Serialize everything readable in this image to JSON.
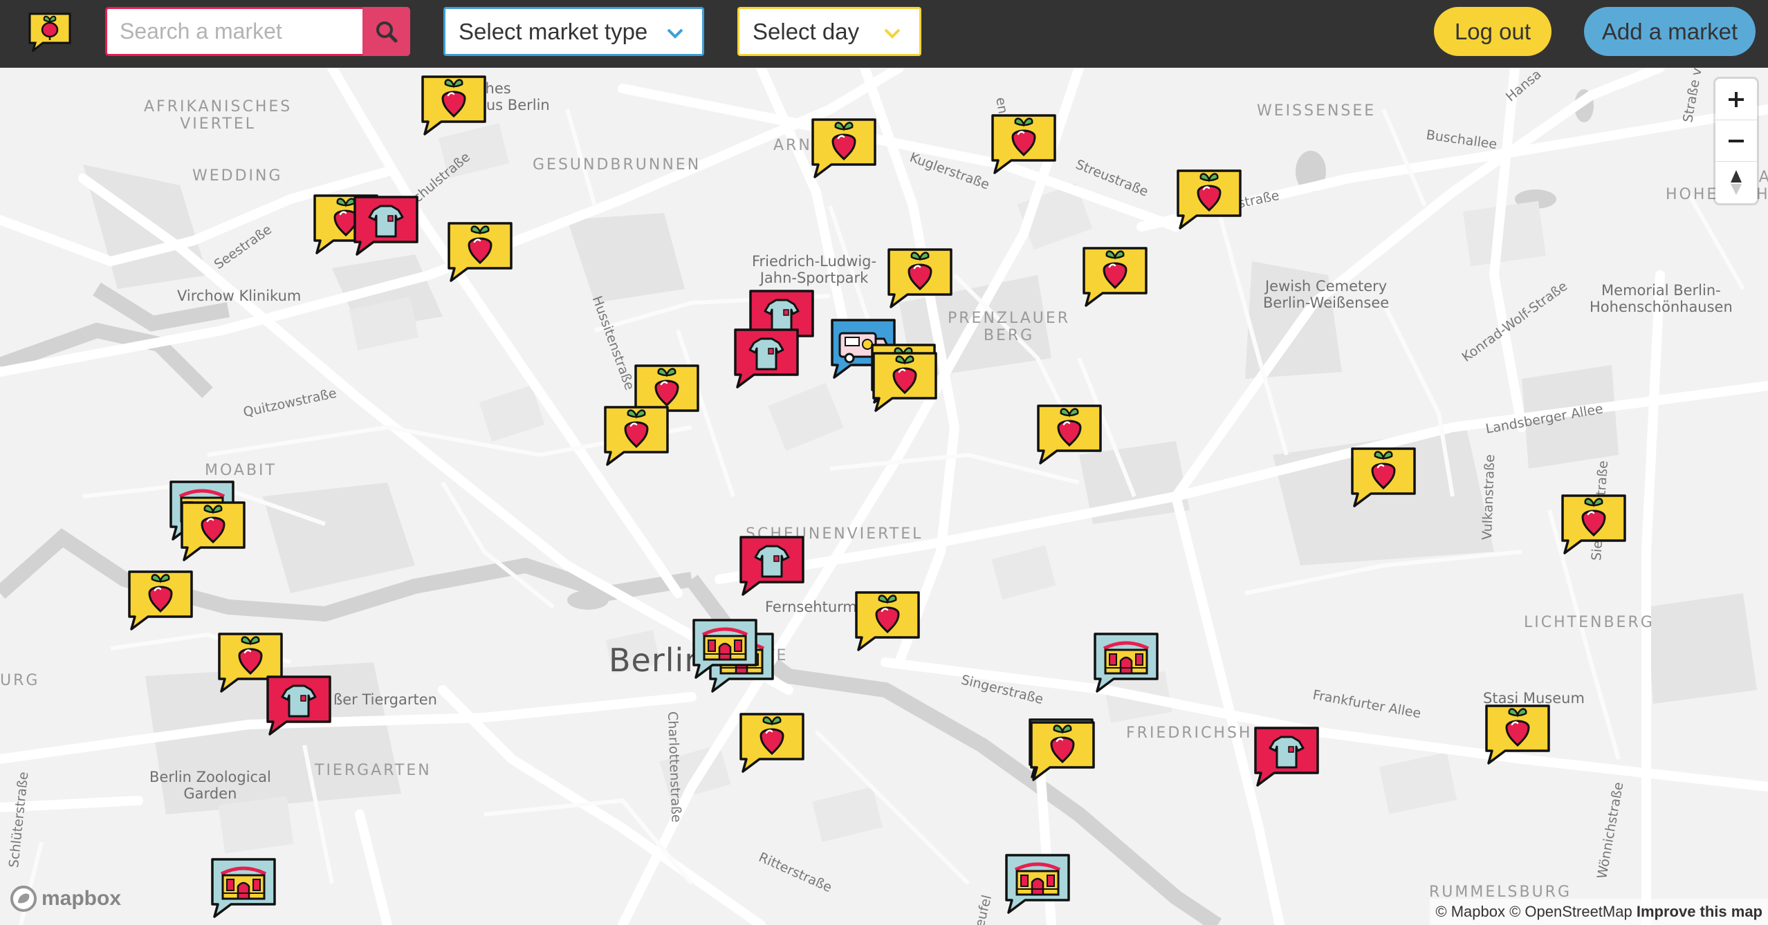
{
  "header": {
    "logo_icon": "beet-speech-bubble-logo",
    "search": {
      "placeholder": "Search a market",
      "value": "",
      "button_icon": "search-icon"
    },
    "market_type_select": {
      "selected": "Select market type",
      "icon": "chevron-down-icon"
    },
    "day_select": {
      "selected": "Select day",
      "icon": "chevron-down-icon"
    },
    "logout_label": "Log out",
    "add_market_label": "Add a market"
  },
  "colors": {
    "header_bg": "#333333",
    "food": "#f7d335",
    "clothing": "#e61f4f",
    "building": "#a9d6db",
    "truck": "#3e9ed9",
    "add_button": "#5aaad8"
  },
  "map": {
    "labels": {
      "afrikanisches": "AFRIKANISCHES\nVIERTEL",
      "wedding": "WEDDING",
      "gesundbrunnen": "GESUNDBRUNNEN",
      "weissensee": "WEISSENSEE",
      "alt_hohenschoen": "ALT-\nHOHENSCHÖN",
      "prenzlauer": "PRENZLAUER\nBERG",
      "moabit": "MOABIT",
      "scheunenviertel": "SCHEUNENVIERTEL",
      "lichtenberg": "LICHTENBERG",
      "friedrichsh": "FRIEDRICHSH",
      "tiergarten": "TIERGARTEN",
      "rummelsburg": "RUMMELSBURG",
      "urg": "URG",
      "arni": "ARNI",
      "mitte": "TE",
      "berlin": "Berlin",
      "virchow": "Virchow Klinikum",
      "fjs": "Friedrich-Ludwig-\nJahn-Sportpark",
      "jewish": "Jewish Cemetery\nBerlin-Weißensee",
      "memorial": "Memorial Berlin-\nHohenschönhausen",
      "fernsehturm": "Fernsehturm",
      "tiergarten_park": "ßer Tiergarten",
      "zoo": "Berlin Zoological\nGarden",
      "stasi": "Stasi Museum",
      "ches": "ches\naus Berlin",
      "seestrasse": "Seestraße",
      "schulstrasse": "chulstraße",
      "quitzow": "Quitzowstraße",
      "hussiten": "Hussitenstraße",
      "kugler": "Kuglerstraße",
      "streu": "Streustraße",
      "enade": "enade",
      "buschallee": "Buschallee",
      "hansa": "Hansa",
      "strasse_vor": "Straße vor",
      "astrasse": "straße",
      "konrad": "Konrad-Wolf-Straße",
      "landsberger": "Landsberger Allee",
      "vulkan": "Vulkanstraße",
      "siegfried": "Siegfriedstraße",
      "singer": "Singerstraße",
      "frankfurter": "Frankfurter Allee",
      "charlotten": "Charlottenstraße",
      "ritter": "Ritterstraße",
      "schlueter": "Schlüterstraße",
      "woennich": "Wönnichstraße",
      "freuz": "eufel"
    },
    "markers": [
      "food",
      "food",
      "food",
      "food",
      "food",
      "clothing",
      "food",
      "food",
      "food",
      "clothing",
      "clothing",
      "food-truck",
      "food",
      "food",
      "food",
      "food",
      "food",
      "food",
      "food",
      "building",
      "food",
      "food",
      "food",
      "clothing",
      "food",
      "clothing",
      "building",
      "building",
      "building",
      "food",
      "building",
      "food",
      "clothing",
      "food",
      "building",
      "building"
    ]
  },
  "controls": {
    "zoom_in_icon": "plus-icon",
    "zoom_out_icon": "minus-icon",
    "compass_icon": "compass-icon"
  },
  "attribution": {
    "logo": "mapbox",
    "text": "© Mapbox © OpenStreetMap",
    "improve": "Improve this map"
  }
}
